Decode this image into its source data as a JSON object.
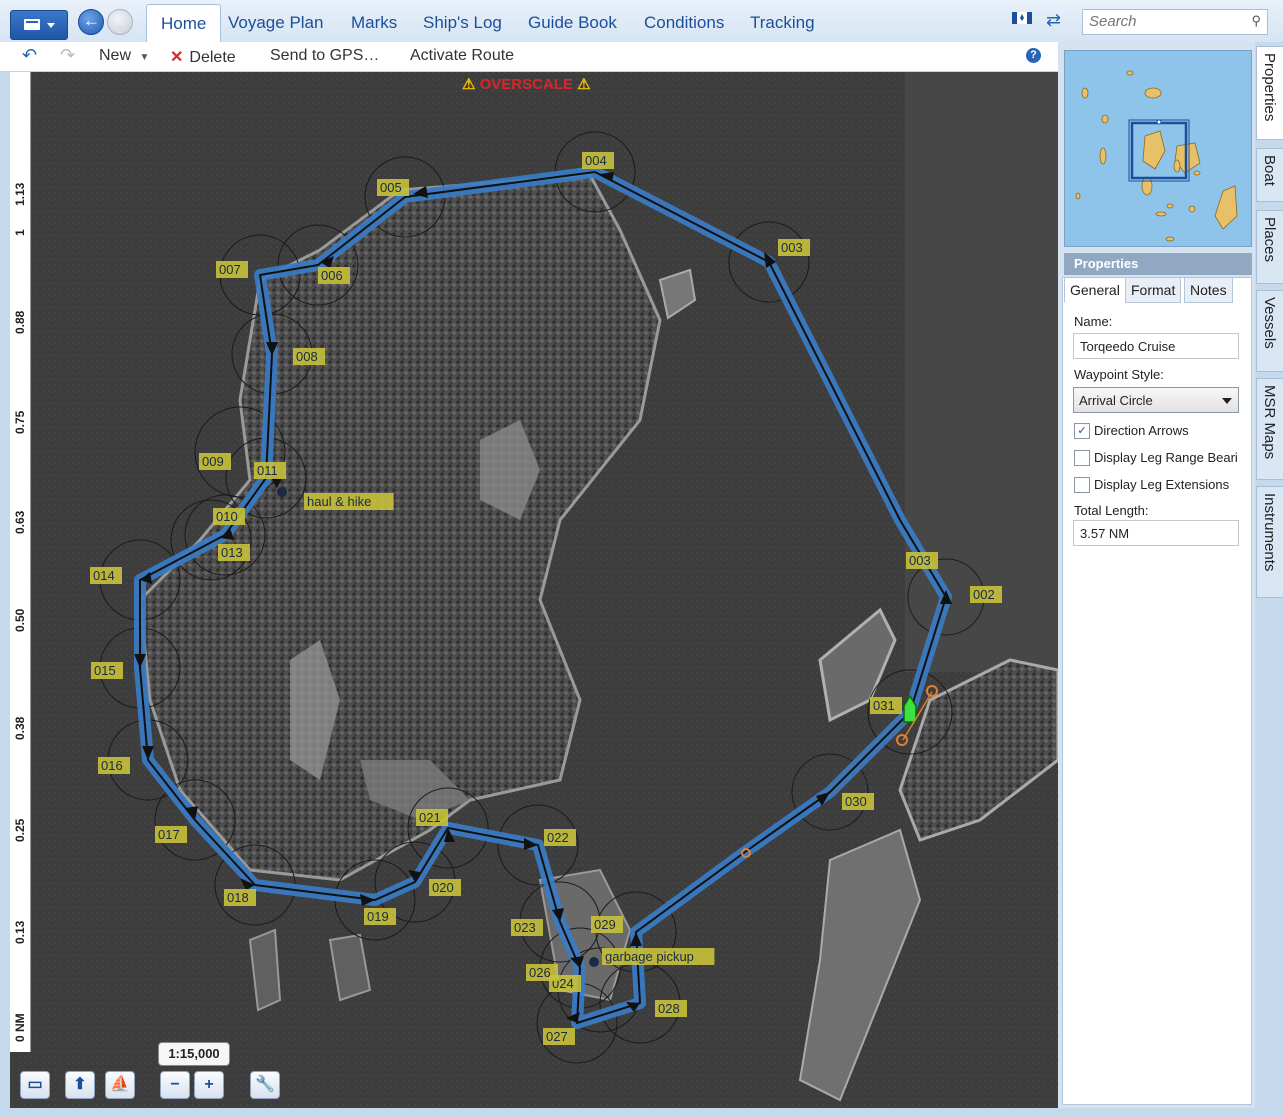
{
  "titlebar": {
    "tabs": [
      "Home",
      "Voyage Plan",
      "Marks",
      "Ship's Log",
      "Guide Book",
      "Conditions",
      "Tracking"
    ],
    "search_placeholder": "Search"
  },
  "toolbar": {
    "new_label": "New",
    "delete_label": "Delete",
    "send_label": "Send to GPS…",
    "activate_label": "Activate Route"
  },
  "map": {
    "overscale": "OVERSCALE",
    "ruler_labels": [
      "1.13",
      "1",
      "0.88",
      "0.75",
      "0.63",
      "0.50",
      "0.38",
      "0.25",
      "0.13",
      "0 NM"
    ],
    "scale": "1:15,000",
    "zoom_out": "−",
    "zoom_in": "+",
    "markers": [
      "haul & hike",
      "garbage pickup"
    ]
  },
  "route": {
    "color": "#3a7cc8",
    "waypoints": [
      {
        "label": "031"
      },
      {
        "label": "002"
      },
      {
        "label": "003"
      },
      {
        "label": "003"
      },
      {
        "label": "004"
      },
      {
        "label": "005"
      },
      {
        "label": "006"
      },
      {
        "label": "007"
      },
      {
        "label": "008"
      },
      {
        "label": "011"
      },
      {
        "label": "009"
      },
      {
        "label": "010"
      },
      {
        "label": "013"
      },
      {
        "label": "014"
      },
      {
        "label": "015"
      },
      {
        "label": "016"
      },
      {
        "label": "017"
      },
      {
        "label": "018"
      },
      {
        "label": "019"
      },
      {
        "label": "020"
      },
      {
        "label": "021"
      },
      {
        "label": "022"
      },
      {
        "label": "023"
      },
      {
        "label": "024"
      },
      {
        "label": "026"
      },
      {
        "label": "027"
      },
      {
        "label": "028"
      },
      {
        "label": "029"
      },
      {
        "label": "030"
      }
    ]
  },
  "panel": {
    "side_tabs": [
      "Properties",
      "Boat",
      "Places",
      "Vessels",
      "MSR Maps",
      "Instruments"
    ],
    "header": "Properties",
    "tabs": [
      "General",
      "Format",
      "Notes"
    ],
    "name_label": "Name:",
    "name_value": "Torqeedo Cruise",
    "style_label": "Waypoint Style:",
    "style_value": "Arrival Circle",
    "checks": [
      {
        "label": "Direction Arrows",
        "checked": true
      },
      {
        "label": "Display Leg Range Beari",
        "checked": false
      },
      {
        "label": "Display Leg Extensions",
        "checked": false
      }
    ],
    "length_label": "Total Length:",
    "length_value": "3.57 NM"
  }
}
